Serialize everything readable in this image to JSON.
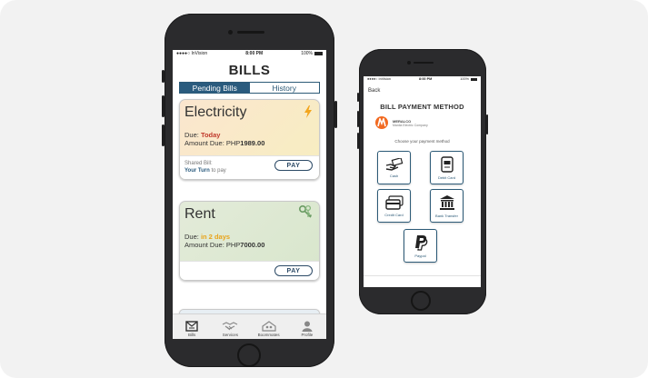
{
  "left_phone": {
    "status": {
      "carrier": "●●●●○ InVision",
      "time": "8:00 PM",
      "battery": "100%"
    },
    "title": "BILLS",
    "tabs": {
      "pending": "Pending Bills",
      "history": "History"
    },
    "electricity": {
      "name": "Electricity",
      "due_label": "Due:",
      "due_value": "Today",
      "amount_label": "Amount Due: PHP",
      "amount_value": "1989.00",
      "shared_label": "Shared Bill:",
      "your_turn": "Your Turn",
      "to_pay": "to pay",
      "pay": "PAY"
    },
    "rent": {
      "name": "Rent",
      "due_label": "Due:",
      "due_value": "in 2 days",
      "amount_label": "Amount Due: PHP",
      "amount_value": "7000.00",
      "pay": "PAY"
    },
    "tabbar": [
      {
        "label": "Bills",
        "icon": "bills-icon"
      },
      {
        "label": "Services",
        "icon": "handshake-icon"
      },
      {
        "label": "Boommates",
        "icon": "house-icon"
      },
      {
        "label": "Profile",
        "icon": "profile-icon"
      }
    ]
  },
  "right_phone": {
    "status": {
      "carrier": "●●●●○ InVision",
      "time": "8:00 PM",
      "battery": "100%"
    },
    "back": "Back",
    "title": "BILL PAYMENT METHOD",
    "biller": {
      "name": "MERALCO",
      "subtitle": "Manila Electric Company"
    },
    "instruction": "Choose your payment method",
    "methods": [
      {
        "label": "Cash",
        "icon": "cash-icon"
      },
      {
        "label": "Debit Card",
        "icon": "debit-card-icon"
      },
      {
        "label": "Credit Card",
        "icon": "credit-card-icon"
      },
      {
        "label": "Bank Transfer",
        "icon": "bank-icon"
      },
      {
        "label": "Paypal",
        "icon": "paypal-icon"
      }
    ]
  },
  "colors": {
    "accent": "#2a5b7e",
    "due_today": "#c0392b",
    "due_soon": "#e8a319",
    "brand_orange": "#f26a21"
  }
}
